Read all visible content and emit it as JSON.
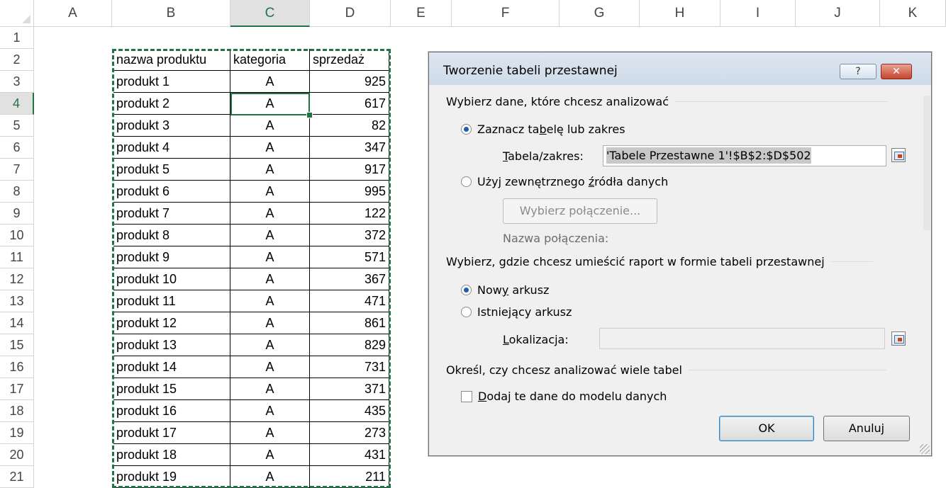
{
  "sheet": {
    "columns": [
      "A",
      "B",
      "C",
      "D",
      "E",
      "F",
      "G",
      "H",
      "I",
      "J",
      "K"
    ],
    "selected_column": "C",
    "row_numbers": [
      "1",
      "2",
      "3",
      "4",
      "5",
      "6",
      "7",
      "8",
      "9",
      "10",
      "11",
      "12",
      "13",
      "14",
      "15",
      "16",
      "17",
      "18",
      "19",
      "20",
      "21"
    ],
    "selected_row": "4",
    "headers": [
      "nazwa produktu",
      "kategoria",
      "sprzedaż"
    ],
    "rows": [
      [
        "produkt 1",
        "A",
        "925"
      ],
      [
        "produkt 2",
        "A",
        "617"
      ],
      [
        "produkt 3",
        "A",
        "82"
      ],
      [
        "produkt 4",
        "A",
        "347"
      ],
      [
        "produkt 5",
        "A",
        "917"
      ],
      [
        "produkt 6",
        "A",
        "995"
      ],
      [
        "produkt 7",
        "A",
        "122"
      ],
      [
        "produkt 8",
        "A",
        "372"
      ],
      [
        "produkt 9",
        "A",
        "571"
      ],
      [
        "produkt 10",
        "A",
        "367"
      ],
      [
        "produkt 11",
        "A",
        "471"
      ],
      [
        "produkt 12",
        "A",
        "861"
      ],
      [
        "produkt 13",
        "A",
        "829"
      ],
      [
        "produkt 14",
        "A",
        "731"
      ],
      [
        "produkt 15",
        "A",
        "371"
      ],
      [
        "produkt 16",
        "A",
        "435"
      ],
      [
        "produkt 17",
        "A",
        "273"
      ],
      [
        "produkt 18",
        "A",
        "431"
      ],
      [
        "produkt 19",
        "A",
        "211"
      ]
    ]
  },
  "dialog": {
    "title": "Tworzenie tabeli przestawnej",
    "help_label": "?",
    "close_label": "✕",
    "section_data": "Wybierz dane, które chcesz analizować",
    "opt_range_pre": "Zaznacz ta",
    "opt_range_u": "b",
    "opt_range_post": "elę lub zakres",
    "range_label_u": "T",
    "range_label_post": "abela/zakres:",
    "range_value": "'Tabele Przestawne 1'!$B$2:$D$502",
    "opt_external_pre": "Użyj zewnętrznego ",
    "opt_external_u": "ź",
    "opt_external_post": "ródła danych",
    "choose_connection": "Wybierz połączenie...",
    "connection_name": "Nazwa połączenia:",
    "section_location": "Wybierz, gdzie chcesz umieścić raport w formie tabeli przestawnej",
    "opt_new_pre": "Now",
    "opt_new_u": "y",
    "opt_new_post": " arkusz",
    "opt_existing_pre": "Istnie",
    "opt_existing_u": "j",
    "opt_existing_post": "ący arkusz",
    "location_label_u": "L",
    "location_label_post": "okalizacja:",
    "location_value": "",
    "section_multi": "Określ, czy chcesz analizować wiele tabel",
    "add_model_u": "D",
    "add_model_post": "odaj te dane do modelu danych",
    "ok_label": "OK",
    "cancel_label": "Anuluj"
  }
}
